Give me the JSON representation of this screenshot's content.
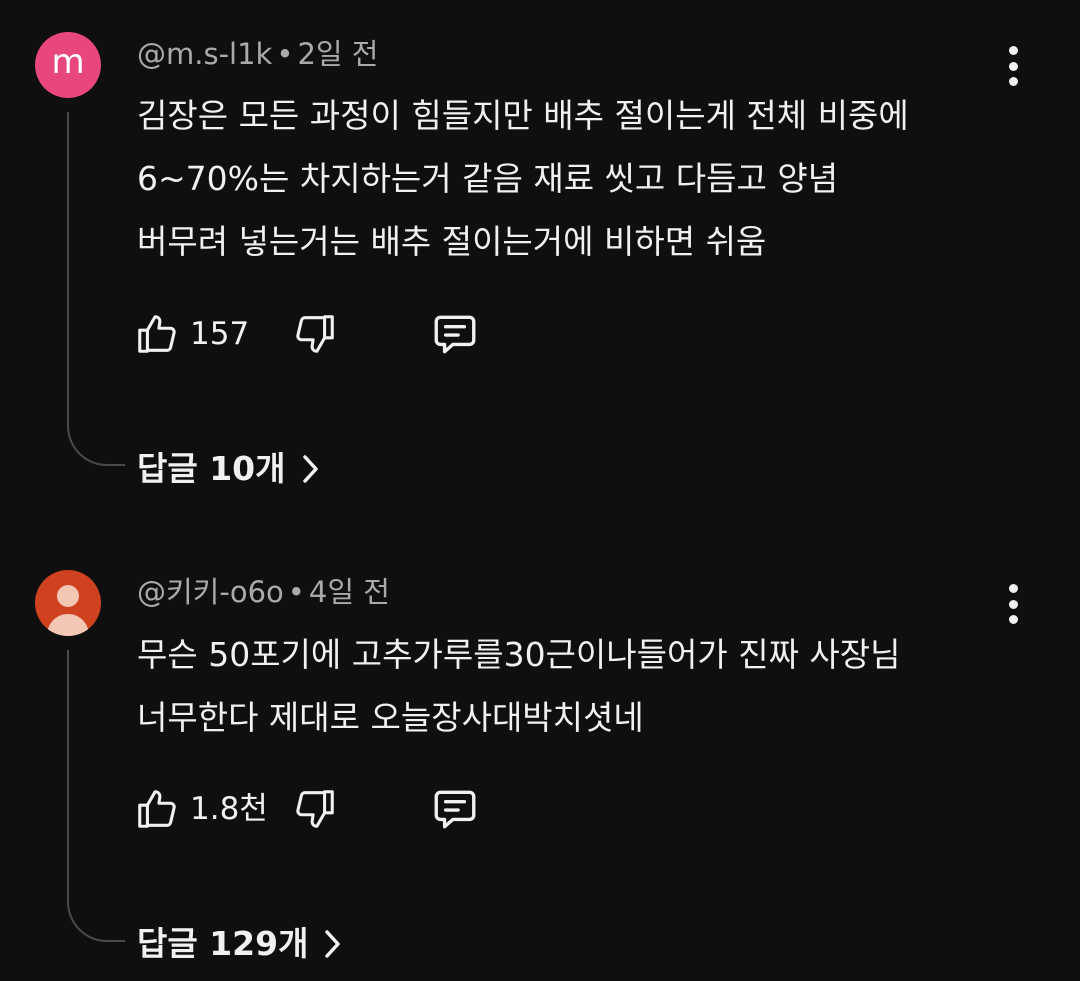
{
  "comments": [
    {
      "avatar_letter": "m",
      "avatar_color": "#e7467e",
      "author": "@m.s-l1k",
      "separator": "•",
      "time": "2일 전",
      "text": "김장은 모든 과정이 힘들지만 배추 절이는게 전체 비중에\n6~70%는 차지하는거 같음 재료 씻고 다듬고 양념\n버무려 넣는거는 배추 절이는거에 비하면 쉬움",
      "likes": "157",
      "replies_label": "답글 10개"
    },
    {
      "avatar_letter": "",
      "avatar_color": "#d0411f",
      "author": "@키키-o6o",
      "separator": "•",
      "time": "4일 전",
      "text": "무슨 50포기에 고추가루를30근이나들어가  진짜 사장님\n너무한다 제대로 오늘장사대박치셧네",
      "likes": "1.8천",
      "replies_label": "답글 129개"
    }
  ],
  "icons": {
    "like": "thumbs-up-icon",
    "dislike": "thumbs-down-icon",
    "reply": "reply-comment-icon",
    "more": "more-vertical-icon",
    "chevron": "chevron-right-icon",
    "avatar_default": "default-person-avatar-icon"
  }
}
